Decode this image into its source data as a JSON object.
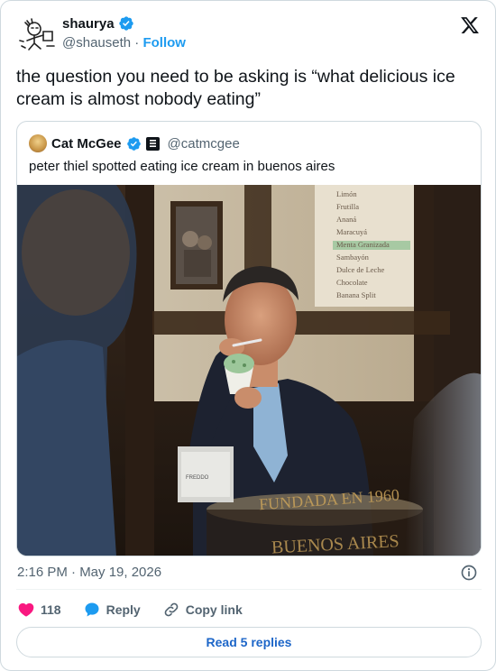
{
  "author": {
    "display_name": "shaurya",
    "handle": "@shauseth",
    "separator": "·",
    "follow_label": "Follow"
  },
  "tweet": {
    "text": "the question you need to be asking is “what delicious ice cream is almost nobody eating”",
    "timestamp": "2:16 PM · May 19, 2026"
  },
  "quote": {
    "display_name": "Cat McGee",
    "handle": "@catmcgee",
    "text": "peter thiel spotted eating ice cream in buenos aires",
    "photo": {
      "menu_items": [
        "Limón",
        "Frutilla",
        "Ananá",
        "Maracuyá",
        "Menta Granizada",
        "Sambayón",
        "Dulce de Leche",
        "Chocolate",
        "Banana Split"
      ],
      "window_lettering_1": "FUNDADA EN 1960",
      "window_lettering_2": "BUENOS AIRES",
      "napkin_label": "FREDDO"
    }
  },
  "actions": {
    "likes": "118",
    "reply_label": "Reply",
    "copy_link_label": "Copy link"
  },
  "footer": {
    "read_replies_label": "Read 5 replies"
  },
  "colors": {
    "accent": "#1d9bf0",
    "like": "#f91880",
    "read_replies_text": "#1d66c8"
  }
}
